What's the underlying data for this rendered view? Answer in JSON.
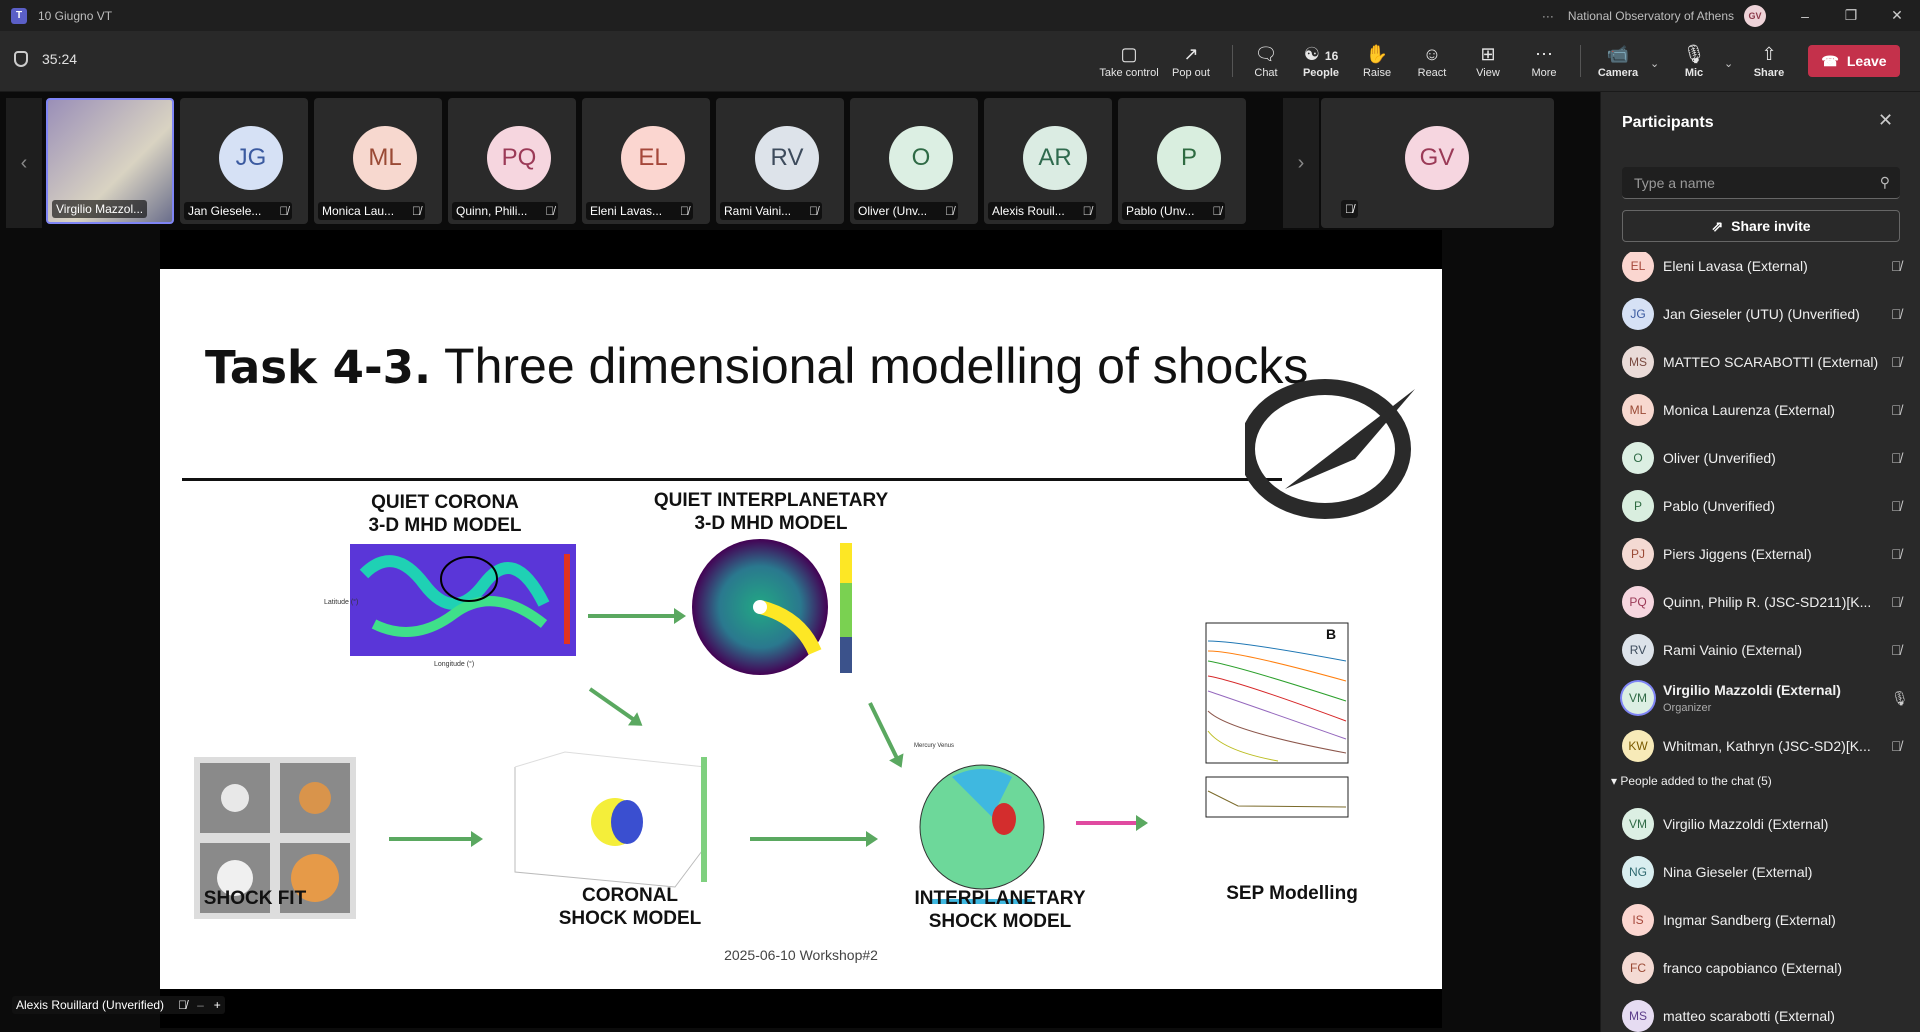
{
  "titlebar": {
    "title": "10 Giugno VT",
    "org": "National Observatory of Athens",
    "avatar": "GV"
  },
  "toolbar": {
    "timer": "35:24",
    "take_control": "Take control",
    "pop_out": "Pop out",
    "chat": "Chat",
    "people": "People",
    "people_count": "16",
    "raise": "Raise",
    "react": "React",
    "view": "View",
    "more": "More",
    "camera": "Camera",
    "mic": "Mic",
    "share": "Share",
    "leave": "Leave"
  },
  "tiles": [
    {
      "initials": "",
      "name": "Virgilio Mazzol...",
      "bg": "#6a6f8a",
      "fg": "#fff"
    },
    {
      "initials": "JG",
      "name": "Jan Giesele...",
      "bg": "#d6e1f5",
      "fg": "#3b5aa0"
    },
    {
      "initials": "ML",
      "name": "Monica Lau...",
      "bg": "#f7d8cf",
      "fg": "#9a4a35"
    },
    {
      "initials": "PQ",
      "name": "Quinn, Phili...",
      "bg": "#f6d6df",
      "fg": "#9b3a57"
    },
    {
      "initials": "EL",
      "name": "Eleni Lavas...",
      "bg": "#fbd6d0",
      "fg": "#a5473a"
    },
    {
      "initials": "RV",
      "name": "Rami Vaini...",
      "bg": "#dde3ea",
      "fg": "#3d4b5c"
    },
    {
      "initials": "O",
      "name": "Oliver (Unv...",
      "bg": "#dcefe3",
      "fg": "#2f6a45"
    },
    {
      "initials": "AR",
      "name": "Alexis Rouil...",
      "bg": "#dbece3",
      "fg": "#2f6a4e"
    },
    {
      "initials": "P",
      "name": "Pablo (Unv...",
      "bg": "#d9eedf",
      "fg": "#2e6b41"
    }
  ],
  "gv_tile": {
    "initials": "GV",
    "bg": "#f6d6e0",
    "fg": "#9b3a57"
  },
  "slide": {
    "title_bold": "Task 4-3.",
    "title_rest": " Three dimensional modelling of shocks",
    "quiet_corona": [
      "QUIET CORONA",
      "3-D MHD MODEL"
    ],
    "quiet_ip": [
      "QUIET INTERPLANETARY",
      "3-D MHD MODEL"
    ],
    "shock_fit": "SHOCK FIT",
    "coronal": [
      "CORONAL",
      "SHOCK MODEL"
    ],
    "interplanetary": [
      "INTERPLANETARY",
      "SHOCK MODEL"
    ],
    "sep": "SEP Modelling",
    "sep_panel": "B",
    "footer": "2025-06-10 Workshop#2"
  },
  "bottom_name": "Alexis Rouillard (Unverified)",
  "panel": {
    "title": "Participants",
    "search_placeholder": "Type a name",
    "invite": "Share invite",
    "participants": [
      {
        "initials": "EL",
        "name": "Eleni Lavasa (External)",
        "bg": "#fbd6d0",
        "fg": "#a5473a"
      },
      {
        "initials": "JG",
        "name": "Jan Gieseler (UTU) (Unverified)",
        "bg": "#d6e1f5",
        "fg": "#3b5aa0"
      },
      {
        "initials": "MS",
        "name": "MATTEO SCARABOTTI (External)",
        "bg": "#eadbd8",
        "fg": "#7a4a40"
      },
      {
        "initials": "ML",
        "name": "Monica Laurenza (External)",
        "bg": "#f7d8cf",
        "fg": "#9a4a35"
      },
      {
        "initials": "O",
        "name": "Oliver (Unverified)",
        "bg": "#dcefe3",
        "fg": "#2f6a45"
      },
      {
        "initials": "P",
        "name": "Pablo (Unverified)",
        "bg": "#d9eedf",
        "fg": "#2e6b41"
      },
      {
        "initials": "PJ",
        "name": "Piers Jiggens (External)",
        "bg": "#f4dad3",
        "fg": "#9a4a35"
      },
      {
        "initials": "PQ",
        "name": "Quinn, Philip R. (JSC-SD211)[K...",
        "bg": "#f6d6df",
        "fg": "#9b3a57"
      },
      {
        "initials": "RV",
        "name": "Rami Vainio (External)",
        "bg": "#dde3ea",
        "fg": "#3d4b5c"
      },
      {
        "initials": "VM",
        "name": "Virgilio Mazzoldi (External)",
        "sub": "Organizer",
        "bg": "#dcefe3",
        "fg": "#2f6a45"
      },
      {
        "initials": "KW",
        "name": "Whitman, Kathryn (JSC-SD2)[K...",
        "bg": "#f7eab8",
        "fg": "#7a5a00"
      }
    ],
    "section": "People added to the chat (5)",
    "chat_people": [
      {
        "initials": "VM",
        "name": "Virgilio Mazzoldi (External)",
        "bg": "#dcefe3",
        "fg": "#2f6a45"
      },
      {
        "initials": "NG",
        "name": "Nina Gieseler (External)",
        "bg": "#d9eef0",
        "fg": "#2f6a70"
      },
      {
        "initials": "IS",
        "name": "Ingmar Sandberg (External)",
        "bg": "#fbd6d0",
        "fg": "#a5473a"
      },
      {
        "initials": "FC",
        "name": "franco capobianco (External)",
        "bg": "#f4dad3",
        "fg": "#9a4a35"
      },
      {
        "initials": "MS",
        "name": "matteo scarabotti (External)",
        "bg": "#e6dcf2",
        "fg": "#5c3d8a"
      }
    ]
  }
}
